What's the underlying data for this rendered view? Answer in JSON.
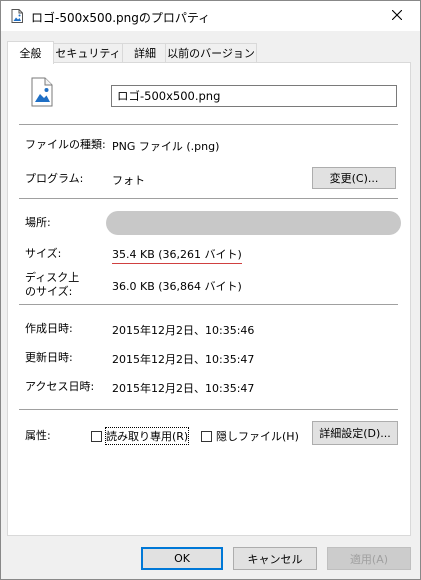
{
  "window": {
    "title": "ロゴ-500x500.pngのプロパティ"
  },
  "tabs": [
    {
      "label": "全般"
    },
    {
      "label": "セキュリティ"
    },
    {
      "label": "詳細"
    },
    {
      "label": "以前のバージョン"
    }
  ],
  "general": {
    "file_name": "ロゴ-500x500.png",
    "type_label": "ファイルの種類:",
    "type_value": "PNG ファイル (.png)",
    "program_label": "プログラム:",
    "program_value": "フォト",
    "change_button": "変更(C)...",
    "location_label": "場所:",
    "size_label": "サイズ:",
    "size_value": "35.4 KB (36,261 バイト)",
    "disk_size_label_line1": "ディスク上",
    "disk_size_label_line2": "のサイズ:",
    "disk_size_value": "36.0 KB (36,864 バイト)",
    "created_label": "作成日時:",
    "created_value": "2015年12月2日、10:35:46",
    "modified_label": "更新日時:",
    "modified_value": "2015年12月2日、10:35:47",
    "accessed_label": "アクセス日時:",
    "accessed_value": "2015年12月2日、10:35:47",
    "attributes_label": "属性:",
    "readonly_label": "読み取り専用(R)",
    "hidden_label": "隠しファイル(H)",
    "advanced_button": "詳細設定(D)..."
  },
  "footer": {
    "ok": "OK",
    "cancel": "キャンセル",
    "apply": "適用(A)"
  },
  "colors": {
    "accent": "#0078d7",
    "size_underline": "#d04040"
  },
  "icons": {
    "title": "image-file-icon",
    "close": "close-icon",
    "file": "image-file-icon"
  }
}
